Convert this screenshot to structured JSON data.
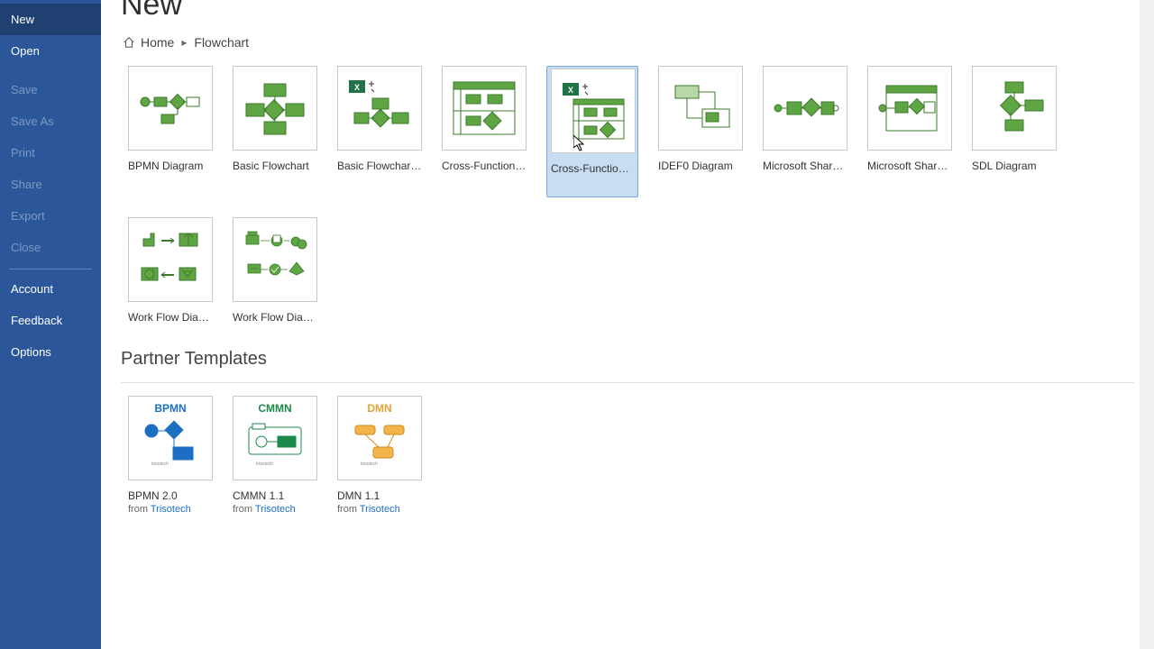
{
  "sidebar": {
    "items": [
      {
        "label": "New",
        "state": "selected"
      },
      {
        "label": "Open",
        "state": "normal"
      },
      {
        "label": "Save",
        "state": "disabled"
      },
      {
        "label": "Save As",
        "state": "disabled"
      },
      {
        "label": "Print",
        "state": "disabled"
      },
      {
        "label": "Share",
        "state": "disabled"
      },
      {
        "label": "Export",
        "state": "disabled"
      },
      {
        "label": "Close",
        "state": "disabled"
      }
    ],
    "footer": [
      {
        "label": "Account"
      },
      {
        "label": "Feedback"
      },
      {
        "label": "Options"
      }
    ]
  },
  "page_title": "New",
  "breadcrumb": {
    "home": "Home",
    "current": "Flowchart"
  },
  "templates": [
    {
      "label": "BPMN Diagram",
      "icon": "bpmn"
    },
    {
      "label": "Basic Flowchart",
      "icon": "basic"
    },
    {
      "label": "Basic Flowchart...",
      "icon": "basic-excel"
    },
    {
      "label": "Cross-Functional...",
      "icon": "crossfunc"
    },
    {
      "label": "Cross-Functional...",
      "icon": "crossfunc-excel",
      "selected": true
    },
    {
      "label": "IDEF0 Diagram",
      "icon": "idef0"
    },
    {
      "label": "Microsoft Share...",
      "icon": "sharepoint1"
    },
    {
      "label": "Microsoft Share...",
      "icon": "sharepoint2"
    },
    {
      "label": "SDL Diagram",
      "icon": "sdl"
    },
    {
      "label": "Work Flow Diagr...",
      "icon": "workflow1"
    },
    {
      "label": "Work Flow Diagr...",
      "icon": "workflow2"
    }
  ],
  "partner_section_title": "Partner Templates",
  "partners": [
    {
      "name": "BPMN",
      "label": "BPMN 2.0",
      "from": "from ",
      "link": "Trisotech",
      "color": "#1b6ec2"
    },
    {
      "name": "CMMN",
      "label": "CMMN 1.1",
      "from": "from ",
      "link": "Trisotech",
      "color": "#1a8a4a"
    },
    {
      "name": "DMN",
      "label": "DMN 1.1",
      "from": "from ",
      "link": "Trisotech",
      "color": "#e8a23a"
    }
  ]
}
